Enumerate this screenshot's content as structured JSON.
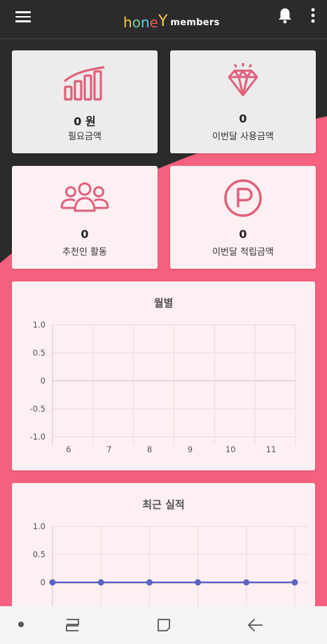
{
  "header": {
    "logo_letters": [
      "h",
      "o",
      "n",
      "e",
      "Y"
    ],
    "logo_colors": [
      "#f2c94c",
      "#6fcf97",
      "#56ccf2",
      "#eb5757",
      "#f2c94c"
    ],
    "logo_suffix": "members"
  },
  "colors": {
    "accent": "#f5607e",
    "icon": "#e0607a",
    "header_bg": "#2b2b2b",
    "line_series": "#5c63c4"
  },
  "stats": [
    {
      "icon": "bar-growth-icon",
      "value": "0 원",
      "label": "필요금액"
    },
    {
      "icon": "diamond-icon",
      "value": "0",
      "label": "이번달 사용금액"
    },
    {
      "icon": "people-group-icon",
      "value": "0",
      "label": "추천인 활동"
    },
    {
      "icon": "point-p-icon",
      "value": "0",
      "label": "이번달 적립금액"
    }
  ],
  "chart_data": [
    {
      "type": "line",
      "title": "월별",
      "categories": [
        "6",
        "7",
        "8",
        "9",
        "10",
        "11"
      ],
      "y_ticks": [
        "1.0",
        "0.5",
        "0",
        "-0.5",
        "-1.0"
      ],
      "ylim": [
        -1.0,
        1.0
      ],
      "series": [],
      "grid": true
    },
    {
      "type": "line",
      "title": "최근 실적",
      "y_ticks": [
        "1.0",
        "0.5",
        "0"
      ],
      "ylim": [
        0,
        1.0
      ],
      "series": [
        {
          "values": [
            0,
            0,
            0,
            0,
            0,
            0
          ],
          "color": "#5c63c4"
        }
      ],
      "grid": true
    }
  ],
  "navbar": {
    "items": [
      "recent-apps-icon",
      "home-icon",
      "back-icon"
    ]
  }
}
